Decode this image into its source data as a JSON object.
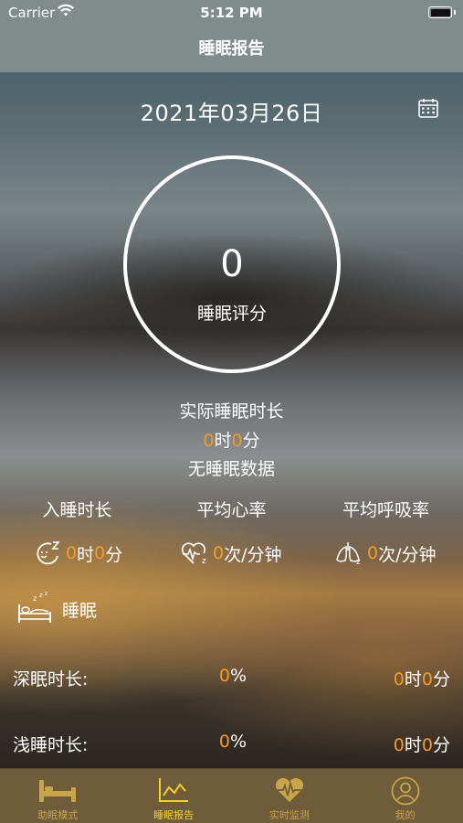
{
  "status_bar": {
    "carrier": "Carrier",
    "time": "5:12 PM"
  },
  "nav": {
    "title": "睡眠报告"
  },
  "report": {
    "date": "2021年03月26日",
    "score": "0",
    "score_label": "睡眠评分",
    "actual_label": "实际睡眠时长",
    "actual_hours": "0",
    "actual_hours_unit": "时",
    "actual_minutes": "0",
    "actual_minutes_unit": "分",
    "no_data": "无睡眠数据"
  },
  "stats": [
    {
      "label": "入睡时长",
      "value_a": "0",
      "unit_a": "时",
      "value_b": "0",
      "unit_b": "分",
      "icon": "fall-asleep-icon"
    },
    {
      "label": "平均心率",
      "value_a": "0",
      "unit_a": "次/分钟",
      "icon": "heart-rate-icon"
    },
    {
      "label": "平均呼吸率",
      "value_a": "0",
      "unit_a": "次/分钟",
      "icon": "lungs-icon"
    }
  ],
  "sleep_section": {
    "label": "睡眠",
    "icon": "bed-sleep-icon"
  },
  "rows": [
    {
      "label": "深眠时长:",
      "pct": "0",
      "pct_unit": "%",
      "hours": "0",
      "hours_unit": "时",
      "minutes": "0",
      "minutes_unit": "分"
    },
    {
      "label": "浅睡时长:",
      "pct": "0",
      "pct_unit": "%",
      "hours": "0",
      "hours_unit": "时",
      "minutes": "0",
      "minutes_unit": "分"
    }
  ],
  "tabs": [
    {
      "label": "助眠模式",
      "icon": "bed-icon",
      "active": false
    },
    {
      "label": "睡眠报告",
      "icon": "chart-icon",
      "active": true
    },
    {
      "label": "实时监测",
      "icon": "heart-pulse-icon",
      "active": false
    },
    {
      "label": "我的",
      "icon": "user-icon",
      "active": false
    }
  ],
  "colors": {
    "accent": "#f59a23",
    "tab_active": "#f3d21c",
    "tab_inactive": "#c8a545",
    "nav_bg": "#7f8c8b",
    "tab_bg": "#6f5c3b"
  }
}
